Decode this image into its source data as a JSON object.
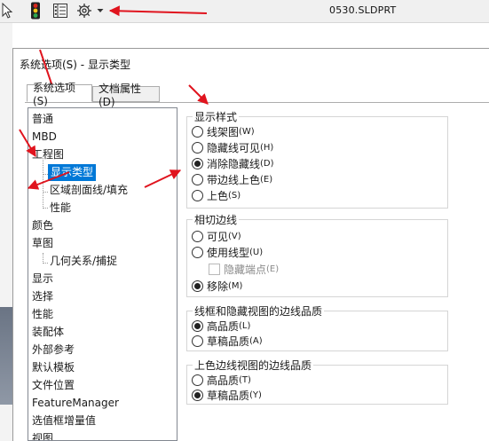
{
  "toolbar": {
    "doc_title": "0530.SLDPRT",
    "icons": [
      "cursor-icon",
      "traffic-light-icon",
      "property-manager-icon",
      "gear-icon",
      "dropdown-caret-icon"
    ]
  },
  "dialog": {
    "title": "系统选项(S) - 显示类型",
    "tabs": [
      {
        "label": "系统选项(S)",
        "active": true
      },
      {
        "label": "文档属性(D)",
        "active": false
      }
    ]
  },
  "tree": {
    "items": [
      {
        "label": "普通"
      },
      {
        "label": "MBD"
      },
      {
        "label": "工程图"
      },
      {
        "label": "显示类型",
        "selected": true
      },
      {
        "label": "区域剖面线/填充"
      },
      {
        "label": "性能"
      },
      {
        "label": "颜色"
      },
      {
        "label": "草图"
      },
      {
        "label": "几何关系/捕捉"
      },
      {
        "label": "显示"
      },
      {
        "label": "选择"
      },
      {
        "label": "性能"
      },
      {
        "label": "装配体"
      },
      {
        "label": "外部参考"
      },
      {
        "label": "默认模板"
      },
      {
        "label": "文件位置"
      },
      {
        "label": "FeatureManager"
      },
      {
        "label": "选值框增量值"
      },
      {
        "label": "视图"
      }
    ]
  },
  "display_style": {
    "title": "显示样式",
    "options": [
      {
        "label": "线架图",
        "accel": "(W)",
        "selected": false
      },
      {
        "label": "隐藏线可见",
        "accel": "(H)",
        "selected": false
      },
      {
        "label": "消除隐藏线",
        "accel": "(D)",
        "selected": true
      },
      {
        "label": "带边线上色",
        "accel": "(E)",
        "selected": false
      },
      {
        "label": "上色",
        "accel": "(S)",
        "selected": false
      }
    ]
  },
  "tangent_edges": {
    "title": "相切边线",
    "options": [
      {
        "label": "可见",
        "accel": "(V)",
        "selected": false
      },
      {
        "label": "使用线型",
        "accel": "(U)",
        "selected": false
      },
      {
        "label": "移除",
        "accel": "(M)",
        "selected": true
      }
    ],
    "hide_endpoints": {
      "label": "隐藏端点",
      "accel": "(E)",
      "checked": false,
      "enabled": false
    }
  },
  "wireframe_quality": {
    "title": "线框和隐藏视图的边线品质",
    "options": [
      {
        "label": "高品质",
        "accel": "(L)",
        "selected": true
      },
      {
        "label": "草稿品质",
        "accel": "(A)",
        "selected": false
      }
    ]
  },
  "shaded_quality": {
    "title": "上色边线视图的边线品质",
    "options": [
      {
        "label": "高品质",
        "accel": "(T)",
        "selected": false
      },
      {
        "label": "草稿品质",
        "accel": "(Y)",
        "selected": true
      }
    ]
  },
  "colors": {
    "selection": "#0078d7",
    "annotation_arrow": "#e0141e",
    "traffic_red": "#d9261c",
    "traffic_yellow": "#f0c419",
    "traffic_green": "#2fa84f"
  }
}
